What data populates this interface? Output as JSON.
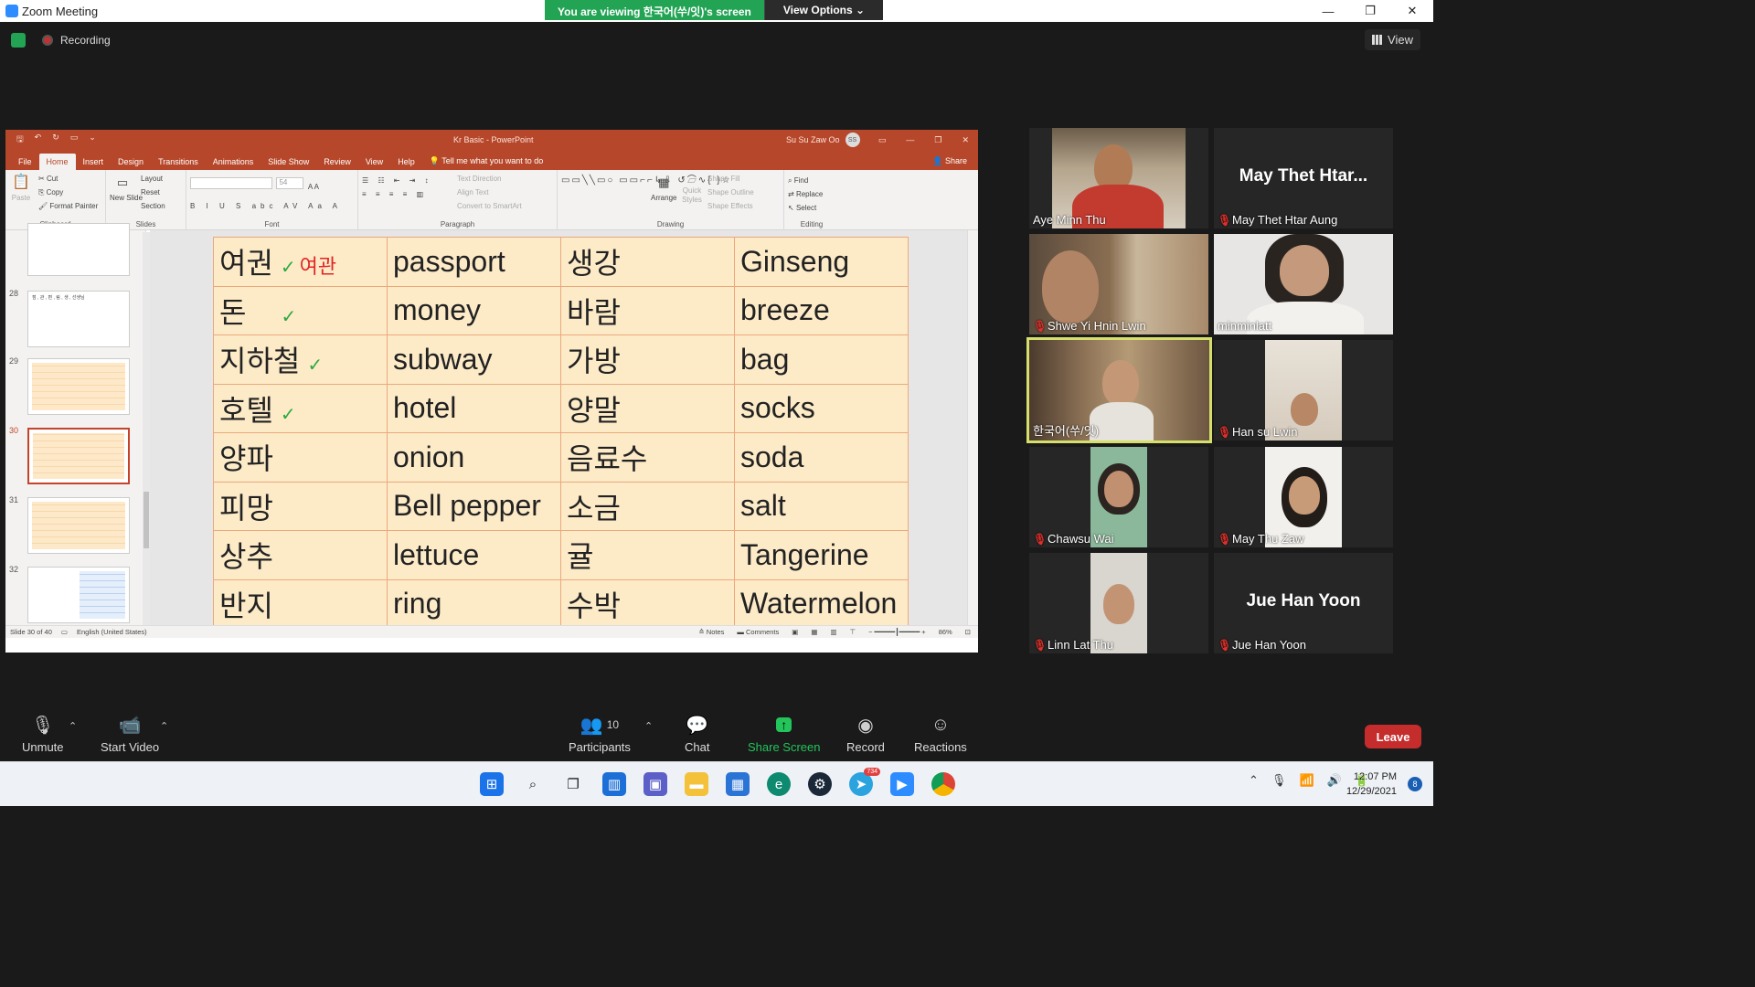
{
  "window": {
    "title": "Zoom Meeting",
    "banner_text": "You are viewing 한국어(쑤/잇)'s screen",
    "view_options": "View Options ⌄",
    "min": "—",
    "restore": "❐",
    "close": "✕"
  },
  "meeting": {
    "recording_label": "Recording",
    "view_label": "View"
  },
  "powerpoint": {
    "title": "Kr Basic  -  PowerPoint",
    "user": "Su Su Zaw Oo",
    "user_initials": "SS",
    "tabs": [
      "File",
      "Home",
      "Insert",
      "Design",
      "Transitions",
      "Animations",
      "Slide Show",
      "Review",
      "View",
      "Help"
    ],
    "tell_me": "Tell me what you want to do",
    "share": "Share",
    "ribbon": {
      "clipboard": {
        "label": "Clipboard",
        "paste": "Paste",
        "cut": "Cut",
        "copy": "Copy",
        "format_painter": "Format Painter"
      },
      "slides": {
        "label": "Slides",
        "new_slide": "New Slide",
        "layout": "Layout",
        "reset": "Reset",
        "section": "Section"
      },
      "font": {
        "label": "Font",
        "size": "54"
      },
      "paragraph": {
        "label": "Paragraph",
        "text_direction": "Text Direction",
        "align_text": "Align Text",
        "smartart": "Convert to SmartArt"
      },
      "drawing": {
        "label": "Drawing",
        "arrange": "Arrange",
        "quick_styles": "Quick Styles",
        "shape_fill": "Shape Fill",
        "shape_outline": "Shape Outline",
        "shape_effects": "Shape Effects"
      },
      "editing": {
        "label": "Editing",
        "find": "Find",
        "replace": "Replace",
        "select": "Select"
      }
    },
    "thumbnails": [
      {
        "num": "28",
        "text": "점 , 관 , 편 , 림 , 생 ,\n선생님"
      },
      {
        "num": "29"
      },
      {
        "num": "30"
      },
      {
        "num": "31"
      },
      {
        "num": "32"
      }
    ],
    "slide_table": [
      [
        "여권",
        "passport",
        "생강",
        " Ginseng"
      ],
      [
        "돈",
        "money",
        "바람",
        "breeze"
      ],
      [
        "지하철",
        "subway",
        "가방",
        "bag"
      ],
      [
        "호텔",
        "hotel",
        "양말",
        "socks"
      ],
      [
        "양파",
        "onion",
        "음료수",
        "soda"
      ],
      [
        "피망",
        "Bell pepper",
        "소금",
        "salt"
      ],
      [
        "상추",
        "lettuce",
        "귤",
        "Tangerine"
      ],
      [
        "반지",
        "ring",
        "수박",
        "Watermelon"
      ]
    ],
    "annotation_red": "여관",
    "check": "✓",
    "status": {
      "slide": "Slide 30 of 40",
      "language": "English (United States)",
      "notes": "Notes",
      "comments": "Comments",
      "zoom": "86%"
    }
  },
  "participants_gallery": [
    {
      "name": "Aye Minn Thu",
      "muted": false
    },
    {
      "name": "May Thet Htar Aung",
      "display": "May Thet Htar...",
      "muted": true
    },
    {
      "name": "Shwe Yi Hnin Lwin",
      "muted": true
    },
    {
      "name": "minminlatt",
      "muted": false
    },
    {
      "name": "한국어(쑤/잇)",
      "muted": false,
      "active": true
    },
    {
      "name": "Han su Lwin",
      "muted": true
    },
    {
      "name": "Chawsu Wai",
      "muted": true
    },
    {
      "name": "May Thu Zaw",
      "muted": true
    },
    {
      "name": "Linn Lat Thu",
      "muted": true
    },
    {
      "name": "Jue Han Yoon",
      "display": "Jue Han Yoon",
      "muted": true
    }
  ],
  "controls": {
    "unmute": "Unmute",
    "start_video": "Start Video",
    "participants": "Participants",
    "participants_count": "10",
    "chat": "Chat",
    "share_screen": "Share Screen",
    "record": "Record",
    "reactions": "Reactions",
    "leave": "Leave"
  },
  "taskbar": {
    "telegram_badge": "734",
    "time": "12:07 PM",
    "date": "12/29/2021",
    "notifications": "8"
  },
  "colors": {
    "zoom_green": "#23a455",
    "ppt_red": "#b7472a",
    "leave_red": "#c52c2c",
    "active_speaker": "#d4e06b"
  }
}
